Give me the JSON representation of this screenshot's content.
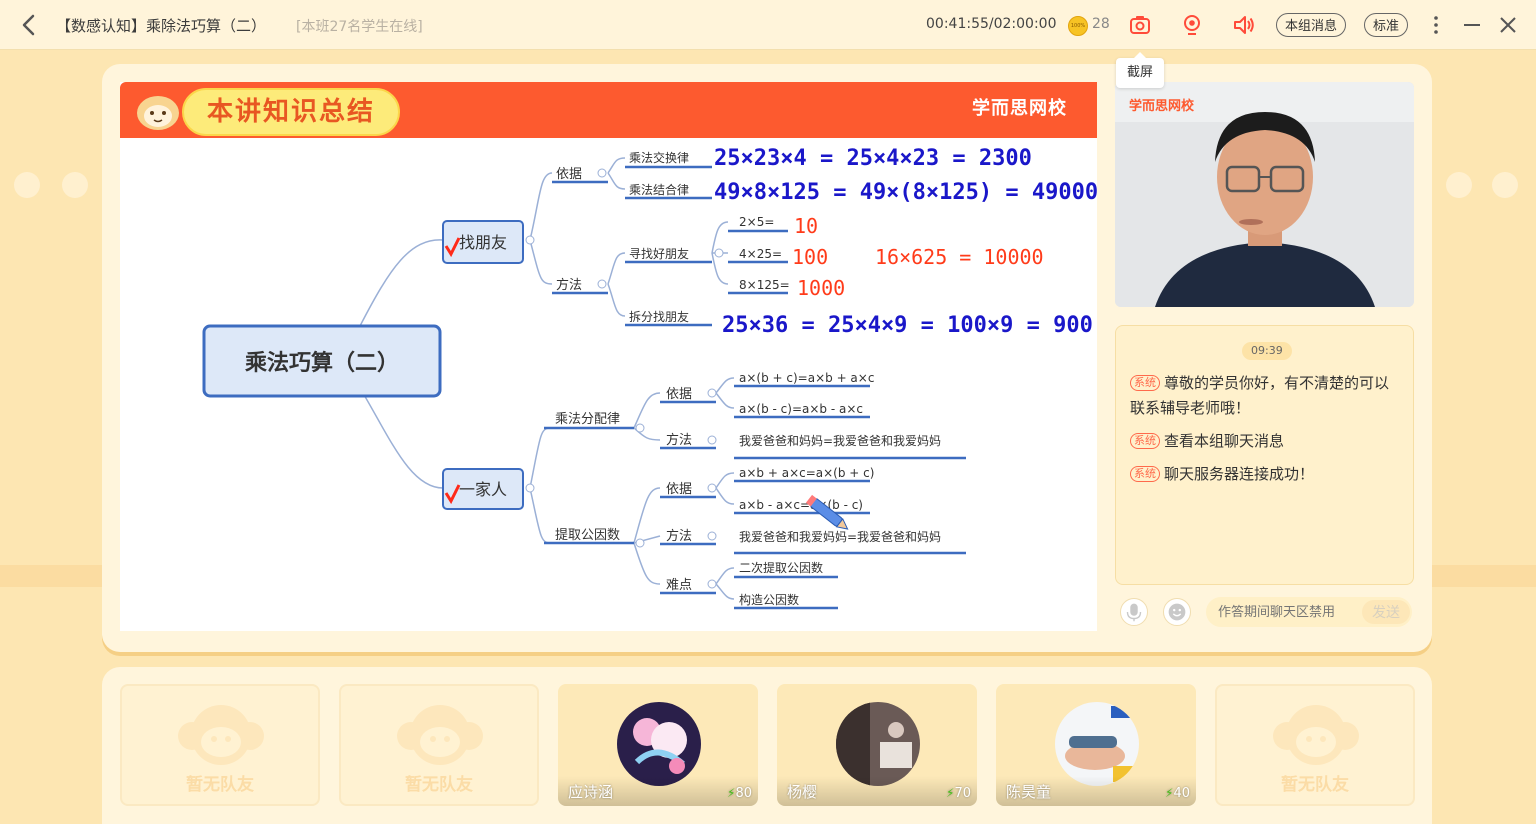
{
  "window": {
    "title": "【数感认知】乘除法巧算（二）",
    "online_status": "[本班27名学生在线]",
    "timer": "00:41:55/02:00:00",
    "coin_label": "100%",
    "coin_count": "28",
    "group_messages_label": "本组消息",
    "quality_label": "标准",
    "screenshot_tooltip": "截屏"
  },
  "slide": {
    "title": "本讲知识总结",
    "brand": "学而思网校",
    "root": "乘法巧算（二）",
    "branch1": {
      "label": "找朋友",
      "basis": "依据",
      "method": "方法",
      "commutative": "乘法交换律",
      "associative": "乘法结合律",
      "find_friends": "寻找好朋友",
      "split_friends": "拆分找朋友",
      "p1": "2×5=",
      "p2": "4×25=",
      "p3": "8×125=",
      "hw1": "25×23×4 = 25×4×23 = 2300",
      "hw2": "49×8×125 = 49×(8×125) = 49000",
      "hw3": "10",
      "hw4": "100",
      "hw5": "1000",
      "hw6": "16×625 = 10000",
      "hw7": "25×36 = 25×4×9 = 100×9 = 900"
    },
    "branch2": {
      "label": "一家人",
      "distributive": "乘法分配律",
      "common_factor": "提取公因数",
      "basis": "依据",
      "method": "方法",
      "basis2": "依据",
      "method2": "方法",
      "difficulty": "难点",
      "f1": "a×(b + c)=a×b + a×c",
      "f2": "a×(b - c)=a×b - a×c",
      "f3": "我爱爸爸和妈妈=我爱爸爸和我爱妈妈",
      "f4": "a×b + a×c=a×(b + c)",
      "f5": "a×b - a×c=a×(b - c)",
      "f6": "我爱爸爸和我爱妈妈=我爱爸爸和妈妈",
      "f7": "二次提取公因数",
      "f8": "构造公因数"
    }
  },
  "video": {
    "brand": "学而思网校"
  },
  "chat": {
    "time": "09:39",
    "sys_tag": "系统",
    "messages": [
      "尊敬的学员你好，有不清楚的可以联系辅导老师哦！",
      "查看本组聊天消息",
      "聊天服务器连接成功！"
    ],
    "input_placeholder": "作答期间聊天区禁用",
    "send_label": "发送"
  },
  "teammates": [
    {
      "empty": true,
      "label": "暂无队友"
    },
    {
      "empty": true,
      "label": "暂无队友"
    },
    {
      "empty": false,
      "name": "应诗涵",
      "score": "80"
    },
    {
      "empty": false,
      "name": "杨樱",
      "score": "70"
    },
    {
      "empty": false,
      "name": "陈昊童",
      "score": "40"
    },
    {
      "empty": true,
      "label": "暂无队友"
    }
  ],
  "colors": {
    "accent": "#fd5a2f",
    "background": "#fde6b2",
    "panel": "#fff5dc",
    "ink_blue": "#1a17c9",
    "ink_red": "#ff3b1a"
  }
}
